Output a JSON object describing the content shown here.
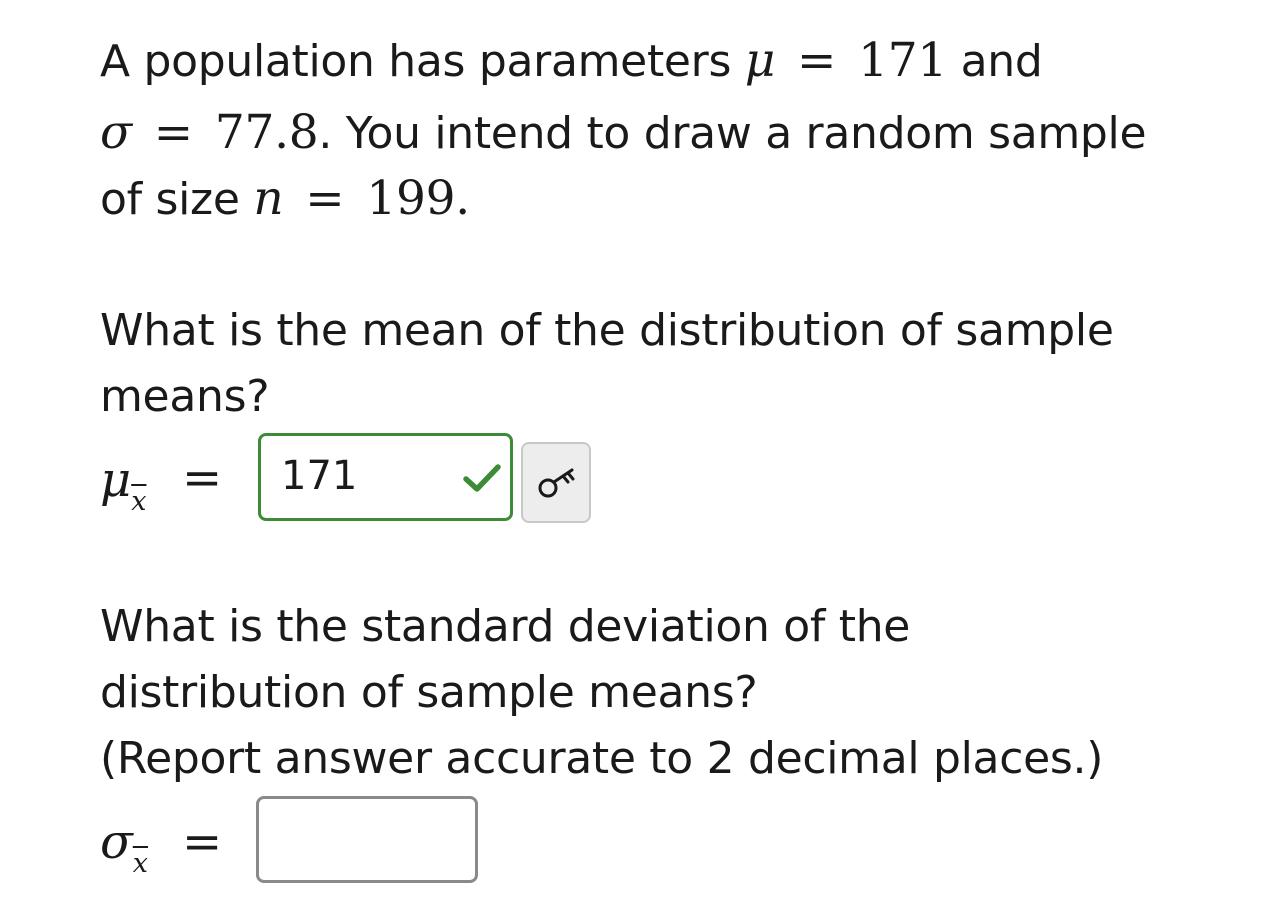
{
  "intro": {
    "line1_text": "A population has parameters",
    "mu_symbol": "μ",
    "equals": "=",
    "mu_value": "171",
    "and_text": "and",
    "sigma_symbol": "σ",
    "sigma_value": "77.8",
    "line2_text": ". You intend to draw a random sample",
    "line3_text": "of size",
    "n_symbol": "n",
    "n_value": "199",
    "period": "."
  },
  "question1": {
    "line1": "What is the mean of the distribution of sample",
    "line2": "means?",
    "label_symbol": "μ",
    "label_subscript": "x",
    "equals": "=",
    "answer_value": "171",
    "status": "correct",
    "status_color": "#3d8b37",
    "status_icon": "check-icon",
    "key_icon": "key-icon"
  },
  "question2": {
    "line1": "What is the standard deviation of the",
    "line2": "distribution of sample means?",
    "line3": "(Report answer accurate to 2 decimal places.)",
    "label_symbol": "σ",
    "label_subscript": "x",
    "equals": "=",
    "answer_value": ""
  }
}
